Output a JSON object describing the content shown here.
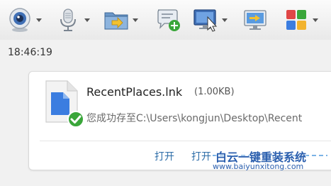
{
  "toolbar": {
    "items": [
      {
        "icon": "webcam-icon",
        "has_dropdown": true
      },
      {
        "icon": "microphone-icon",
        "has_dropdown": true
      },
      {
        "icon": "send-file-icon",
        "has_dropdown": true
      },
      {
        "icon": "add-chat-icon",
        "has_dropdown": false
      },
      {
        "icon": "remote-desktop-icon",
        "has_dropdown": true
      },
      {
        "icon": "screen-share-icon",
        "has_dropdown": false
      },
      {
        "icon": "apps-grid-icon",
        "has_dropdown": true
      }
    ]
  },
  "message": {
    "time": "18:46:19",
    "file_name": "RecentPlaces.lnk",
    "file_size": "(1.00KB)",
    "status_text": "您成功存至C:\\Users\\kongjun\\Desktop\\Recent",
    "actions": {
      "open": "打开",
      "open_folder": "打开"
    }
  },
  "watermark": {
    "line1": "白云一键重装系统",
    "line2": "www.baiyunxitong.com"
  },
  "colors": {
    "link": "#2d6da8",
    "file_icon_blue": "#3b7de0",
    "success_green": "#3aa63a",
    "watermark": "#2b5fae"
  }
}
